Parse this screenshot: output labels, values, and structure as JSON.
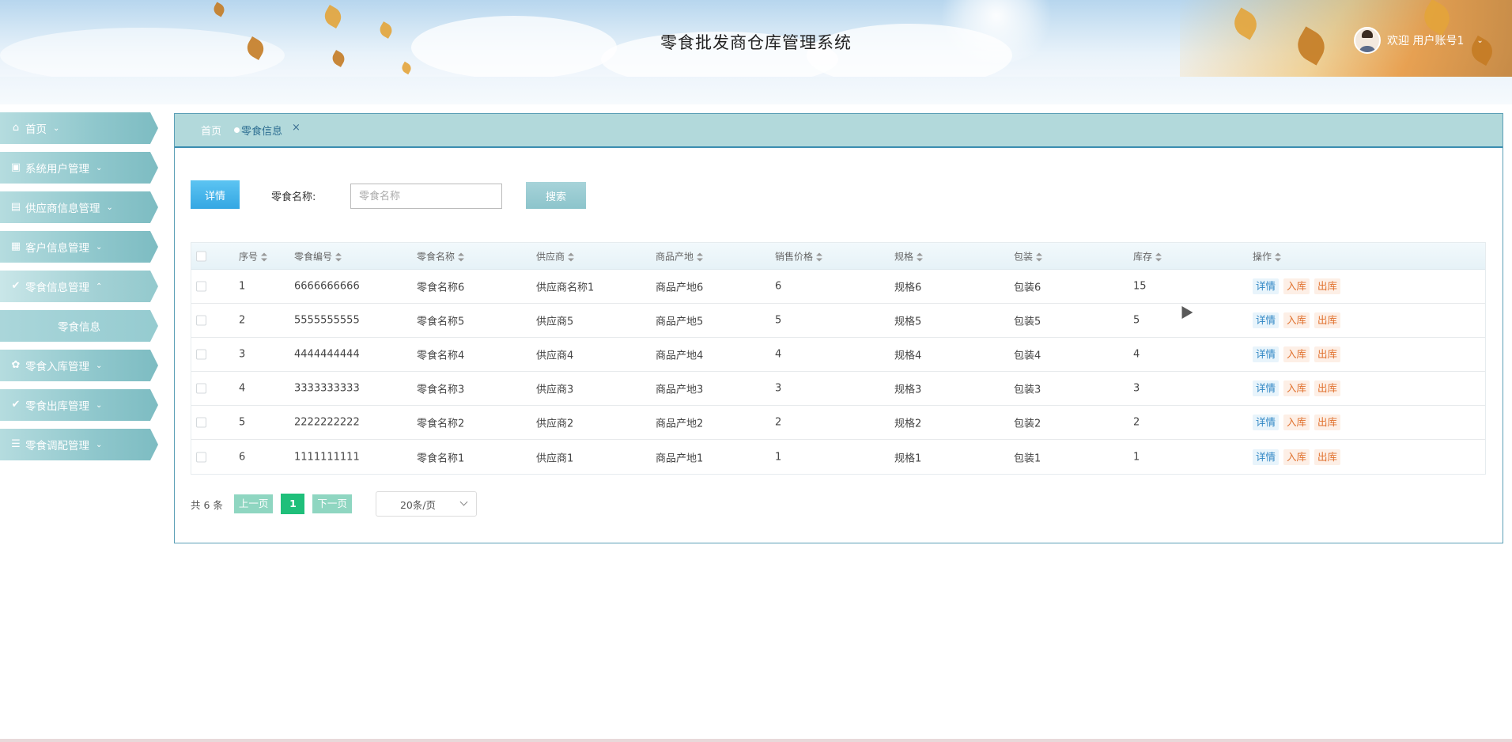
{
  "header": {
    "title": "零食批发商仓库管理系统",
    "welcome": "欢迎 用户账号1"
  },
  "sidebar": {
    "items": [
      {
        "label": "首页",
        "icon": "home-icon"
      },
      {
        "label": "系统用户管理",
        "icon": "crop-icon"
      },
      {
        "label": "供应商信息管理",
        "icon": "card-icon"
      },
      {
        "label": "客户信息管理",
        "icon": "grid-icon"
      },
      {
        "label": "零食信息管理",
        "icon": "check-circle-icon"
      },
      {
        "label": "零食信息",
        "icon": ""
      },
      {
        "label": "零食入库管理",
        "icon": "apps-icon"
      },
      {
        "label": "零食出库管理",
        "icon": "check-circle-icon"
      },
      {
        "label": "零食调配管理",
        "icon": "list-icon"
      }
    ]
  },
  "tabs": {
    "home": "首页",
    "active": "零食信息",
    "close": "×"
  },
  "toolbar": {
    "detail_label": "详情",
    "search_label": "零食名称:",
    "search_placeholder": "零食名称",
    "search_button": "搜索"
  },
  "table": {
    "columns": [
      "序号",
      "零食编号",
      "零食名称",
      "供应商",
      "商品产地",
      "销售价格",
      "规格",
      "包装",
      "库存",
      "操作"
    ],
    "rows": [
      {
        "idx": "1",
        "code": "6666666666",
        "name": "零食名称6",
        "supplier": "供应商名称1",
        "origin": "商品产地6",
        "price": "6",
        "spec": "规格6",
        "pack": "包装6",
        "stock": "15"
      },
      {
        "idx": "2",
        "code": "5555555555",
        "name": "零食名称5",
        "supplier": "供应商5",
        "origin": "商品产地5",
        "price": "5",
        "spec": "规格5",
        "pack": "包装5",
        "stock": "5"
      },
      {
        "idx": "3",
        "code": "4444444444",
        "name": "零食名称4",
        "supplier": "供应商4",
        "origin": "商品产地4",
        "price": "4",
        "spec": "规格4",
        "pack": "包装4",
        "stock": "4"
      },
      {
        "idx": "4",
        "code": "3333333333",
        "name": "零食名称3",
        "supplier": "供应商3",
        "origin": "商品产地3",
        "price": "3",
        "spec": "规格3",
        "pack": "包装3",
        "stock": "3"
      },
      {
        "idx": "5",
        "code": "2222222222",
        "name": "零食名称2",
        "supplier": "供应商2",
        "origin": "商品产地2",
        "price": "2",
        "spec": "规格2",
        "pack": "包装2",
        "stock": "2"
      },
      {
        "idx": "6",
        "code": "1111111111",
        "name": "零食名称1",
        "supplier": "供应商1",
        "origin": "商品产地1",
        "price": "1",
        "spec": "规格1",
        "pack": "包装1",
        "stock": "1"
      }
    ],
    "actions": {
      "detail": "详情",
      "in": "入库",
      "out": "出库"
    }
  },
  "pagination": {
    "total": "共 6 条",
    "prev": "上一页",
    "page": "1",
    "next": "下一页",
    "page_size": "20条/页"
  },
  "colors": {
    "sidebar": "#8fc7cc",
    "tabs_bar": "#b2d9db",
    "accent_blue": "#34a7e3",
    "page_active": "#1fbf7a"
  }
}
